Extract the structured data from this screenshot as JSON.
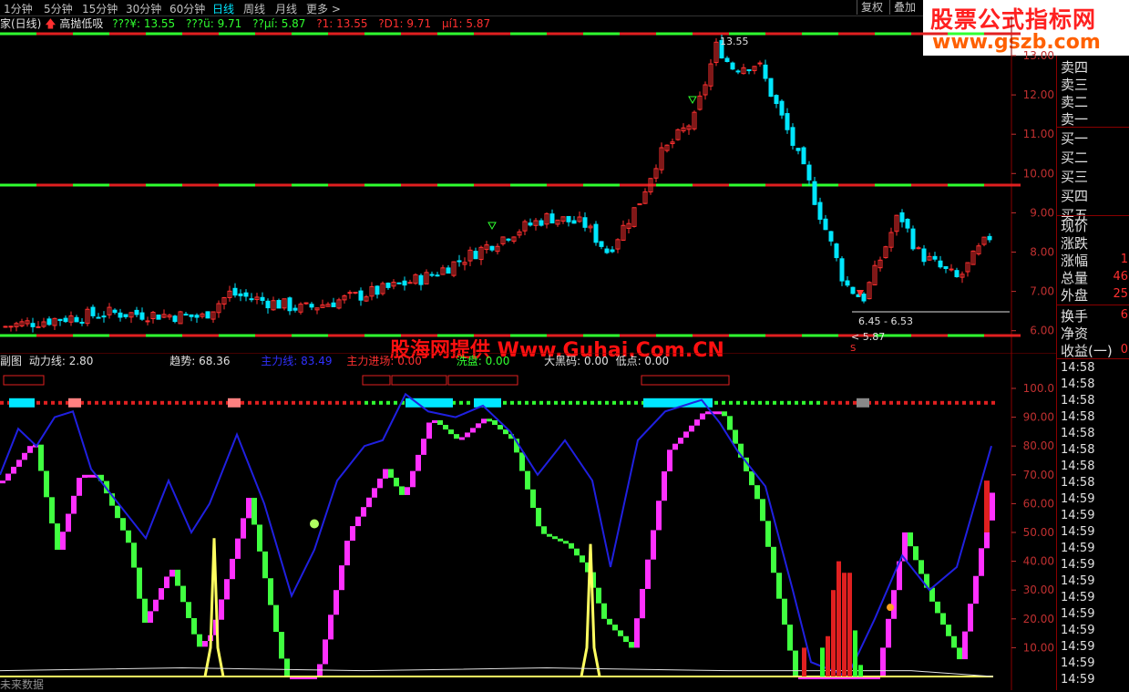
{
  "toolbar": {
    "timeframes": [
      "1分钟",
      "5分钟",
      "15分钟",
      "30分钟",
      "60分钟",
      "日线",
      "周线",
      "月线",
      "更多 >"
    ],
    "active_timeframe": "日线",
    "buttons": [
      "复权",
      "叠加"
    ]
  },
  "logo": {
    "line1": "股票公式指标网",
    "line2": "www.gszb.com"
  },
  "main_info": {
    "title": "家(日线)",
    "indicator": "高抛低吸",
    "values": [
      "???¥: 13.55",
      "???ü: 9.71",
      "??µí: 5.87",
      "?1: 13.55",
      "?D1: 9.71",
      "µí1: 5.87"
    ]
  },
  "main_axis": [
    "13.00",
    "12.00",
    "11.00",
    "10.00",
    "9.00",
    "8.00",
    "7.00",
    "6.00"
  ],
  "annotations": {
    "high": "13.55",
    "range": "6.45 - 6.53",
    "low": "5.87",
    "marker": "S"
  },
  "watermark": "股海网提供 Www.Guhai.Com.CN",
  "sub_info": {
    "title": "副图",
    "items": [
      {
        "label": "动力线: 2.80",
        "color": "#e0e0e0"
      },
      {
        "label": "趋势: 68.36",
        "color": "#e0e0e0"
      },
      {
        "label": "主力线: 83.49",
        "color": "#3030ff"
      },
      {
        "label": "主力进场: 0.00",
        "color": "#ff3030"
      },
      {
        "label": "洗盘: 0.00",
        "color": "#30ff30"
      },
      {
        "label": "大黑码: 0.00",
        "color": "#e0e0e0"
      },
      {
        "label": "低点: 0.00",
        "color": "#e0e0e0"
      }
    ]
  },
  "sub_axis": [
    "100.0",
    "90.00",
    "80.00",
    "70.00",
    "60.00",
    "50.00",
    "40.00",
    "30.00",
    "20.00",
    "10.00"
  ],
  "quote_panel": {
    "sell": [
      "卖四",
      "卖三",
      "卖二",
      "卖一"
    ],
    "buy": [
      "买一",
      "买二",
      "买三",
      "买四",
      "买五"
    ],
    "stats": [
      {
        "label": "现价",
        "value": ""
      },
      {
        "label": "涨跌",
        "value": ""
      },
      {
        "label": "涨幅",
        "value": "1"
      },
      {
        "label": "总量",
        "value": "46"
      },
      {
        "label": "外盘",
        "value": "25"
      },
      {
        "label": "换手",
        "value": "6"
      },
      {
        "label": "净资",
        "value": ""
      },
      {
        "label": "收益(一)",
        "value": "0"
      }
    ],
    "times": [
      "14:58",
      "14:58",
      "14:58",
      "14:58",
      "14:58",
      "14:58",
      "14:58",
      "14:58",
      "14:59",
      "14:59",
      "14:59",
      "14:59",
      "14:59",
      "14:59",
      "14:59",
      "14:59",
      "14:59",
      "14:59",
      "14:59",
      "14:59"
    ]
  },
  "footer": "未来数据",
  "colors": {
    "up": "#ff3030",
    "down": "#00e6ff",
    "ma_green": "#30ff30",
    "ma_red": "#e02020",
    "blue_line": "#2020e0",
    "magenta": "#ff30ff",
    "green_step": "#40ff40",
    "yellow": "#ffff60"
  }
}
